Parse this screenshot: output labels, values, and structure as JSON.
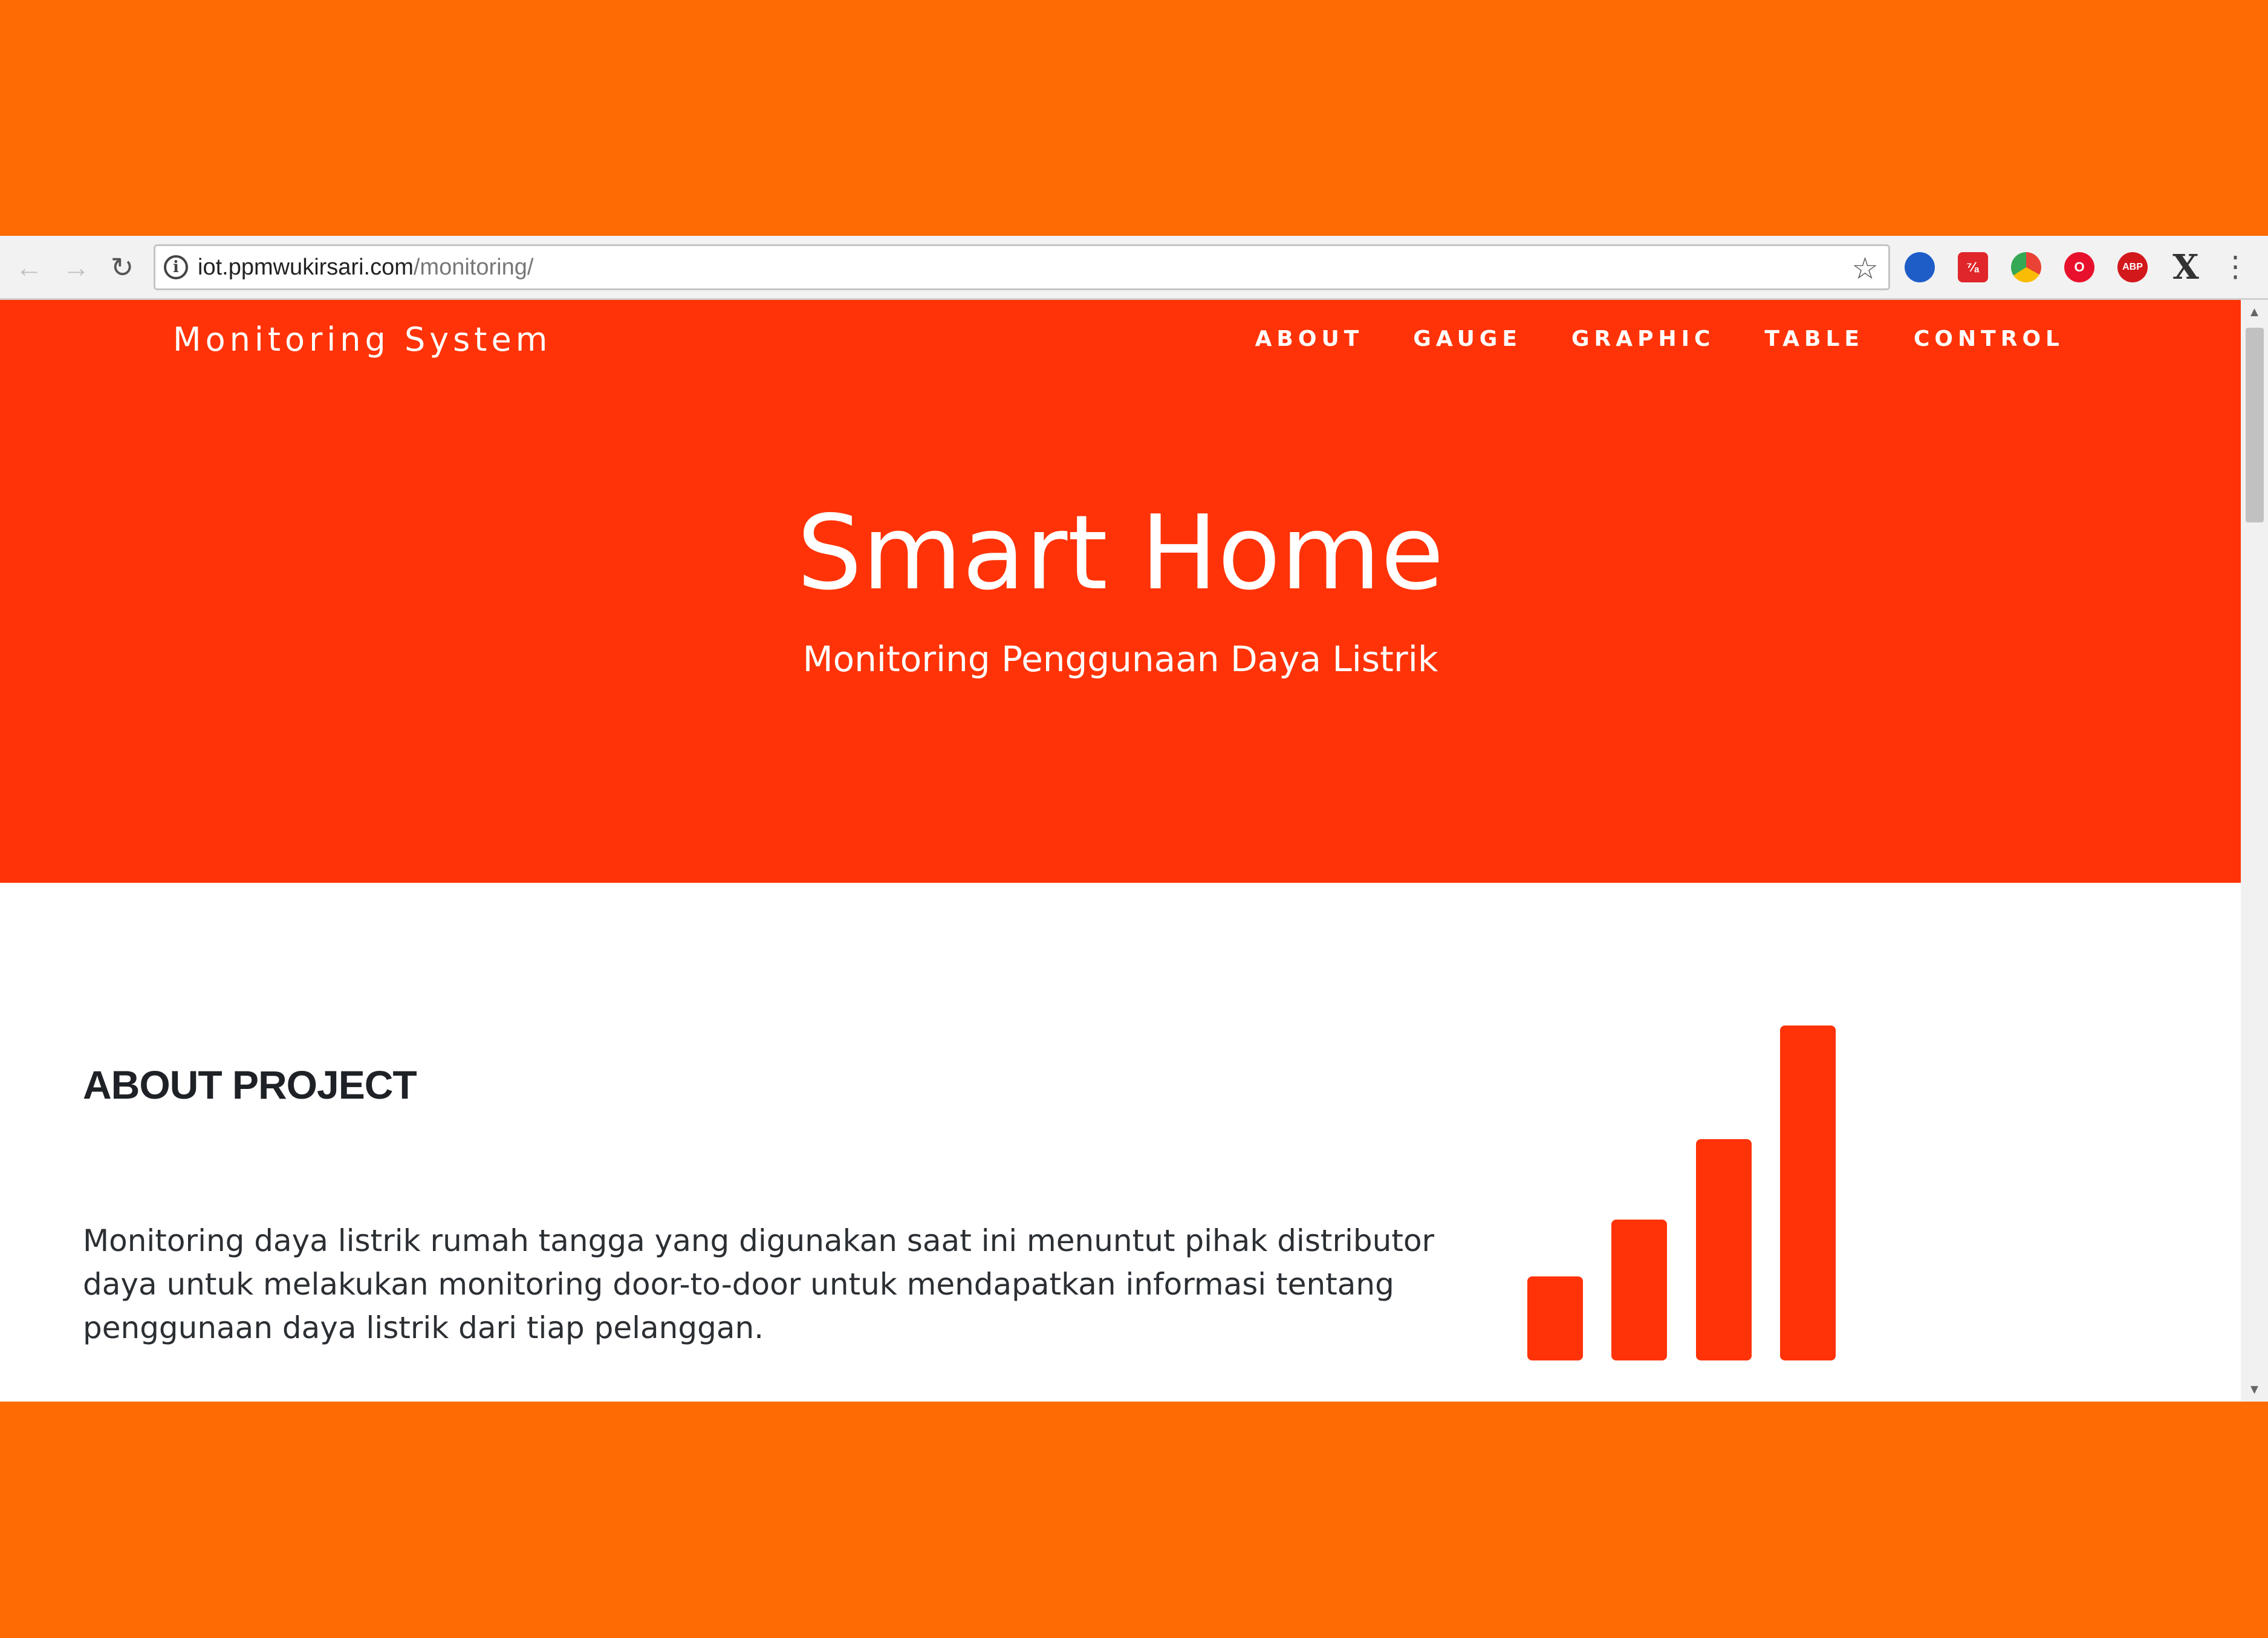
{
  "browser": {
    "url_host": "iot.ppmwukirsari.com",
    "url_path": "/monitoring/",
    "icons": {
      "back": "arrow-left-icon",
      "forward": "arrow-right-icon",
      "reload": "reload-icon",
      "info": "info-icon",
      "star": "star-icon",
      "menu": "kebab-menu-icon"
    },
    "extensions": [
      {
        "name": "extension-icon-1",
        "glyph": ""
      },
      {
        "name": "extension-icon-2",
        "glyph": "⁷⁄ₐ"
      },
      {
        "name": "extension-icon-3",
        "glyph": ""
      },
      {
        "name": "extension-icon-4",
        "glyph": "O"
      },
      {
        "name": "adblock-icon",
        "glyph": "ABP"
      },
      {
        "name": "extension-x-icon",
        "glyph": "X"
      }
    ]
  },
  "site": {
    "brand": "Monitoring System",
    "nav": [
      "ABOUT",
      "GAUGE",
      "GRAPHIC",
      "TABLE",
      "CONTROL"
    ],
    "hero": {
      "title": "Smart Home",
      "subtitle": "Monitoring Penggunaan Daya Listrik"
    },
    "about": {
      "title": "ABOUT PROJECT",
      "text": "Monitoring daya listrik rumah tangga yang digunakan saat ini menuntut pihak distributor daya untuk melakukan monitoring door-to-door untuk mendapatkan informasi tentang penggunaan daya listrik dari tiap pelanggan."
    },
    "signal_icon": {
      "name": "signal-bars-icon",
      "bar_levels": [
        0.25,
        0.42,
        0.66,
        1.0
      ]
    }
  },
  "colors": {
    "outer_background": "#ff6b03",
    "hero_background": "#ff3307",
    "accent": "#ff3307",
    "text_dark": "#1e2226"
  }
}
